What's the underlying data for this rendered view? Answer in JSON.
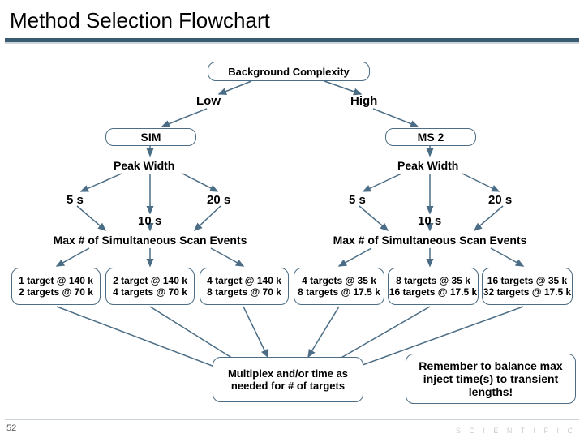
{
  "title": "Method Selection Flowchart",
  "page_number": "52",
  "footer_brand": "S C I E N T I F I C",
  "root": {
    "label": "Background Complexity"
  },
  "branch_labels": {
    "low": "Low",
    "high": "High"
  },
  "left": {
    "method": "SIM",
    "peak_width_label": "Peak Width",
    "pw5": "5 s",
    "pw10": "10 s",
    "pw20": "20 s",
    "scan_header": "Max # of Simultaneous Scan Events",
    "col1_l1": "1 target @ 140 k",
    "col1_l2": "2 targets @ 70 k",
    "col2_l1": "2 target @ 140 k",
    "col2_l2": "4 targets @ 70 k",
    "col3_l1": "4 target @ 140 k",
    "col3_l2": "8 targets @ 70 k"
  },
  "right": {
    "method": "MS 2",
    "peak_width_label": "Peak Width",
    "pw5": "5 s",
    "pw10": "10 s",
    "pw20": "20 s",
    "scan_header": "Max # of Simultaneous Scan Events",
    "col1_l1": "4 targets @ 35 k",
    "col1_l2": "8 targets @ 17.5 k",
    "col2_l1": "8 targets @ 35 k",
    "col2_l2": "16 targets @ 17.5 k",
    "col3_l1": "16 targets @ 35 k",
    "col3_l2": "32 targets @ 17.5 k"
  },
  "bottom": {
    "multiplex": "Multiplex and/or time as needed for # of targets",
    "reminder": "Remember to balance max inject time(s) to transient lengths!"
  }
}
